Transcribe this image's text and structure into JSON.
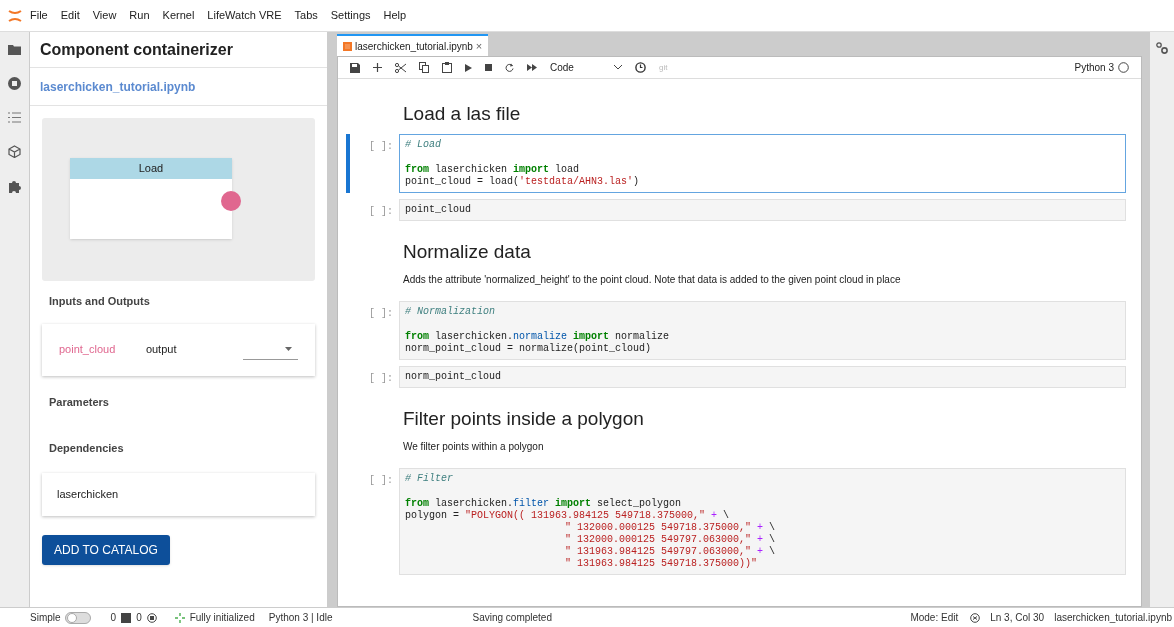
{
  "menu": [
    "File",
    "Edit",
    "View",
    "Run",
    "Kernel",
    "LifeWatch VRE",
    "Tabs",
    "Settings",
    "Help"
  ],
  "left_panel": {
    "title": "Component containerizer",
    "notebook_link": "laserchicken_tutorial.ipynb",
    "node": {
      "title": "Load"
    },
    "inputs_heading": "Inputs and Outputs",
    "io_rows": [
      {
        "name": "point_cloud",
        "type": "output"
      }
    ],
    "parameters_heading": "Parameters",
    "dependencies_heading": "Dependencies",
    "dependencies": [
      "laserchicken"
    ],
    "button": "ADD TO CATALOG"
  },
  "notebook": {
    "tab": {
      "label": "laserchicken_tutorial.ipynb",
      "close": "×"
    },
    "cell_type": "Code",
    "git": "git",
    "kernel": "Python 3",
    "cells": [
      {
        "kind": "heading",
        "text": "Load a las file"
      },
      {
        "kind": "code",
        "prompt": "[ ]:",
        "selected": true,
        "comment": "# Load",
        "lines": [
          {
            "continuation": false,
            "tokens": [
              {
                "kind": "keyword",
                "text": "from"
              },
              {
                "kind": "plain",
                "text": " laserchicken "
              },
              {
                "kind": "keyword",
                "text": "import"
              },
              {
                "kind": "plain",
                "text": " load"
              }
            ]
          },
          {
            "continuation": false,
            "tokens": [
              {
                "kind": "plain",
                "text": "point_cloud = load("
              },
              {
                "kind": "string",
                "text": "'testdata/AHN3.las'"
              },
              {
                "kind": "plain",
                "text": ")"
              }
            ]
          }
        ]
      },
      {
        "kind": "code",
        "prompt": "[ ]:",
        "selected": false,
        "lines": [
          {
            "continuation": false,
            "tokens": [
              {
                "kind": "plain",
                "text": "point_cloud"
              }
            ]
          }
        ]
      },
      {
        "kind": "heading",
        "text": "Normalize data"
      },
      {
        "kind": "paragraph",
        "text": "Adds the attribute 'normalized_height' to the point cloud. Note that data is added to the given point cloud in place"
      },
      {
        "kind": "code",
        "prompt": "[ ]:",
        "selected": false,
        "comment": "# Normalization",
        "lines": [
          {
            "continuation": false,
            "tokens": [
              {
                "kind": "keyword",
                "text": "from"
              },
              {
                "kind": "plain",
                "text": " laserchicken."
              },
              {
                "kind": "module",
                "text": "normalize"
              },
              {
                "kind": "keyword",
                "text": " import"
              },
              {
                "kind": "plain",
                "text": " normalize"
              }
            ]
          },
          {
            "continuation": false,
            "tokens": [
              {
                "kind": "plain",
                "text": "norm_point_cloud = normalize(point_cloud)"
              }
            ]
          }
        ]
      },
      {
        "kind": "code",
        "prompt": "[ ]:",
        "selected": false,
        "lines": [
          {
            "continuation": false,
            "tokens": [
              {
                "kind": "plain",
                "text": "norm_point_cloud"
              }
            ]
          }
        ]
      },
      {
        "kind": "heading",
        "text": "Filter points inside a polygon"
      },
      {
        "kind": "paragraph",
        "text": "We filter points within a polygon"
      },
      {
        "kind": "code",
        "prompt": "[ ]:",
        "selected": false,
        "comment": "# Filter",
        "lines": [
          {
            "continuation": false,
            "tokens": [
              {
                "kind": "keyword",
                "text": "from"
              },
              {
                "kind": "plain",
                "text": " laserchicken."
              },
              {
                "kind": "module",
                "text": "filter"
              },
              {
                "kind": "keyword",
                "text": " import"
              },
              {
                "kind": "plain",
                "text": " select_polygon"
              }
            ]
          },
          {
            "continuation": false,
            "tokens": [
              {
                "kind": "plain",
                "text": "polygon = "
              },
              {
                "kind": "string",
                "text": "\"POLYGON(( 131963.984125 549718.375000,\""
              },
              {
                "kind": "operator",
                "text": " +"
              },
              {
                "kind": "plain",
                "text": " \\"
              }
            ]
          },
          {
            "continuation": true,
            "tokens": [
              {
                "kind": "string",
                "text": "\" 132000.000125 549718.375000,\""
              },
              {
                "kind": "operator",
                "text": " +"
              },
              {
                "kind": "plain",
                "text": " \\"
              }
            ]
          },
          {
            "continuation": true,
            "tokens": [
              {
                "kind": "string",
                "text": "\" 132000.000125 549797.063000,\""
              },
              {
                "kind": "operator",
                "text": " +"
              },
              {
                "kind": "plain",
                "text": " \\"
              }
            ]
          },
          {
            "continuation": true,
            "tokens": [
              {
                "kind": "string",
                "text": "\" 131963.984125 549797.063000,\""
              },
              {
                "kind": "operator",
                "text": " +"
              },
              {
                "kind": "plain",
                "text": " \\"
              }
            ]
          },
          {
            "continuation": true,
            "tokens": [
              {
                "kind": "string",
                "text": "\" 131963.984125 549718.375000))\""
              }
            ]
          }
        ]
      }
    ]
  },
  "status_bar": {
    "mode_label": "Simple",
    "simple_on": false,
    "terminals": "0",
    "kernels": "0",
    "init": "Fully initialized",
    "kernel": "Python 3 | Idle",
    "saving": "Saving completed",
    "mode": "Mode: Edit",
    "position": "Ln 3, Col 30",
    "file": "laserchicken_tutorial.ipynb"
  }
}
